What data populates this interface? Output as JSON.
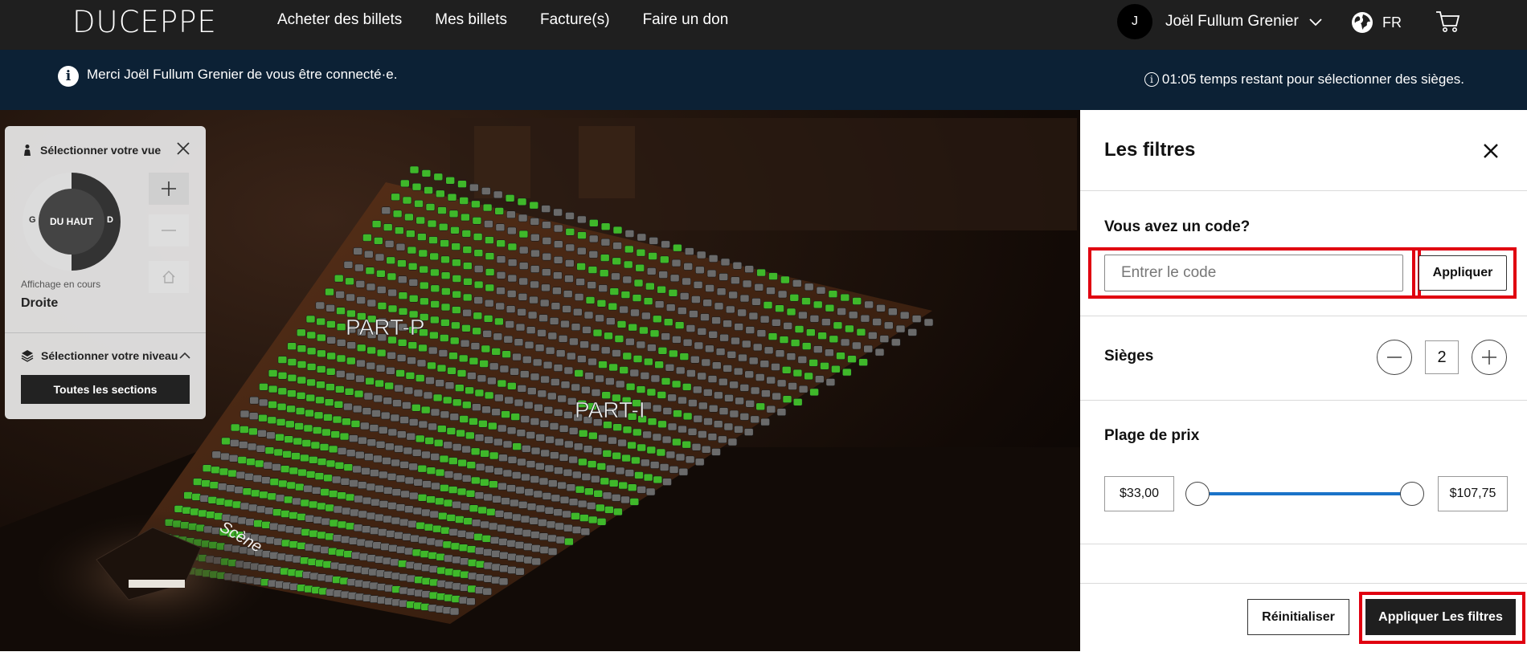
{
  "header": {
    "logo": "DUCEPPE",
    "nav": [
      "Acheter des billets",
      "Mes billets",
      "Facture(s)",
      "Faire un don"
    ],
    "user_initial": "J",
    "user_name": "Joël Fullum Grenier",
    "language": "FR"
  },
  "notice": {
    "message": "Merci Joël Fullum Grenier de vous être connecté·e.",
    "timer": "01:05 temps restant pour sélectionner des sièges."
  },
  "map": {
    "section_labels": [
      "PART-P",
      "PART-I"
    ],
    "stage_label": "Scène",
    "colors": {
      "available": "#3fb82a",
      "unavailable": "#6a6a6a",
      "floor": "#6b3b1f"
    }
  },
  "view_panel": {
    "title": "Sélectionner votre vue",
    "dial_center": "DU HAUT",
    "dial_left": "G",
    "dial_right": "D",
    "current_view_label": "Affichage en cours",
    "current_view_value": "Droite",
    "level_title": "Sélectionner votre niveau",
    "sections_button": "Toutes les sections"
  },
  "filters": {
    "title": "Les filtres",
    "code_label": "Vous avez un code?",
    "code_placeholder": "Entrer le code",
    "code_value": "",
    "apply_code": "Appliquer",
    "seats_label": "Sièges",
    "seats_value": "2",
    "price_label": "Plage de prix",
    "price_min": "$33,00",
    "price_max": "$107,75",
    "reset": "Réinitialiser",
    "apply_filters": "Appliquer Les filtres",
    "accent_color": "#1a73c8",
    "highlight_color": "#e00010"
  }
}
